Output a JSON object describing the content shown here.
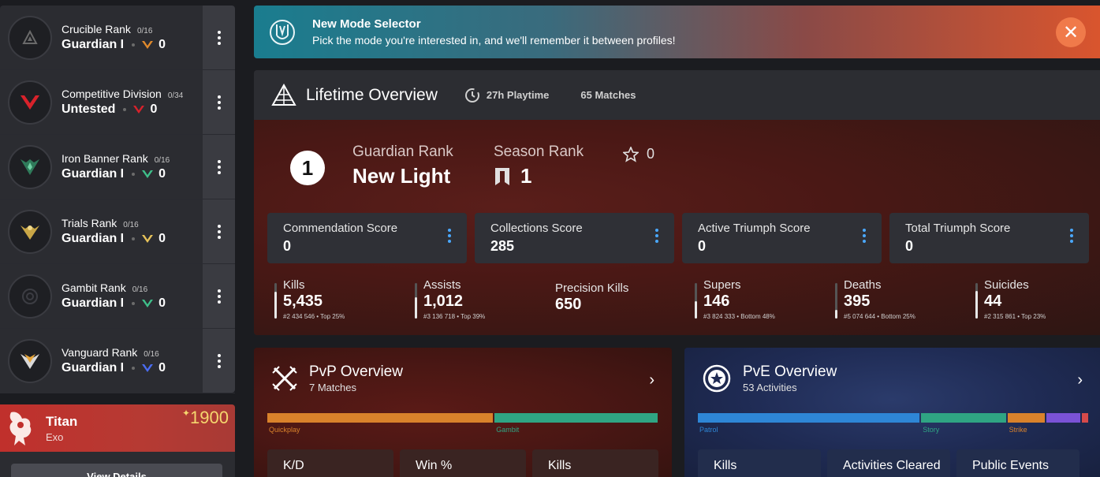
{
  "sidebar": {
    "ranks": [
      {
        "name": "Crucible Rank",
        "progress": "0/16",
        "value": "Guardian I",
        "count": "0",
        "emblem": "crucible-emblem-icon",
        "accent": "#e08a2c"
      },
      {
        "name": "Competitive Division",
        "progress": "0/34",
        "value": "Untested",
        "count": "0",
        "emblem": "competitive-emblem-icon",
        "accent": "#d8222b"
      },
      {
        "name": "Iron Banner Rank",
        "progress": "0/16",
        "value": "Guardian I",
        "count": "0",
        "emblem": "iron-banner-emblem-icon",
        "accent": "#3fbf8a"
      },
      {
        "name": "Trials Rank",
        "progress": "0/16",
        "value": "Guardian I",
        "count": "0",
        "emblem": "trials-emblem-icon",
        "accent": "#e6c25a"
      },
      {
        "name": "Gambit Rank",
        "progress": "0/16",
        "value": "Guardian I",
        "count": "0",
        "emblem": "gambit-emblem-icon",
        "accent": "#3fbf8a"
      },
      {
        "name": "Vanguard Rank",
        "progress": "0/16",
        "value": "Guardian I",
        "count": "0",
        "emblem": "vanguard-emblem-icon",
        "accent": "#4a6cf0"
      }
    ],
    "character": {
      "class": "Titan",
      "race": "Exo",
      "power": "1900",
      "power_prefix": "✦",
      "button": "View Details"
    }
  },
  "banner": {
    "title": "New Mode Selector",
    "body": "Pick the mode you're interested in, and we'll remember it between profiles!",
    "close": "✕"
  },
  "lifetime": {
    "title": "Lifetime Overview",
    "playtime": "27h Playtime",
    "matches": "65 Matches",
    "guardian_rank_number": "1",
    "guardian_rank_label": "Guardian Rank",
    "guardian_rank_value": "New Light",
    "season_rank_label": "Season Rank",
    "season_rank_value": "1",
    "bright_stars": "0",
    "scores": [
      {
        "label": "Commendation Score",
        "value": "0"
      },
      {
        "label": "Collections Score",
        "value": "285"
      },
      {
        "label": "Active Triumph Score",
        "value": "0"
      },
      {
        "label": "Total Triumph Score",
        "value": "0"
      }
    ],
    "stats": [
      {
        "label": "Kills",
        "value": "5,435",
        "detail": "#2 434 546 • Top 25%",
        "fill": 0.75
      },
      {
        "label": "Assists",
        "value": "1,012",
        "detail": "#3 136 718 • Top 39%",
        "fill": 0.61
      },
      {
        "label": "Precision Kills",
        "value": "650",
        "detail": "",
        "fill": null
      },
      {
        "label": "Supers",
        "value": "146",
        "detail": "#3 824 333 • Bottom 48%",
        "fill": 0.48
      },
      {
        "label": "Deaths",
        "value": "395",
        "detail": "#5 074 644 • Bottom 25%",
        "fill": 0.25
      },
      {
        "label": "Suicides",
        "value": "44",
        "detail": "#2 315 861 • Top 23%",
        "fill": 0.77
      }
    ]
  },
  "pvp": {
    "title": "PvP Overview",
    "subtitle": "7 Matches",
    "modes": [
      {
        "label": "Quickplay",
        "share": 0.58,
        "color": "#d9822b"
      },
      {
        "label": "Gambit",
        "share": 0.42,
        "color": "#2fa583"
      }
    ],
    "cards": [
      "K/D",
      "Win %",
      "Kills"
    ]
  },
  "pve": {
    "title": "PvE Overview",
    "subtitle": "53 Activities",
    "modes": [
      {
        "label": "Patrol",
        "share": 0.57,
        "color": "#2e86d6"
      },
      {
        "label": "Story",
        "share": 0.22,
        "color": "#2fa583"
      },
      {
        "label": "Strike",
        "share": 0.1,
        "color": "#d9822b"
      },
      {
        "label": "",
        "share": 0.09,
        "color": "#7a52d6"
      },
      {
        "label": "",
        "share": 0.02,
        "color": "#d64a4a"
      }
    ],
    "cards": [
      "Kills",
      "Activities Cleared",
      "Public Events"
    ]
  }
}
